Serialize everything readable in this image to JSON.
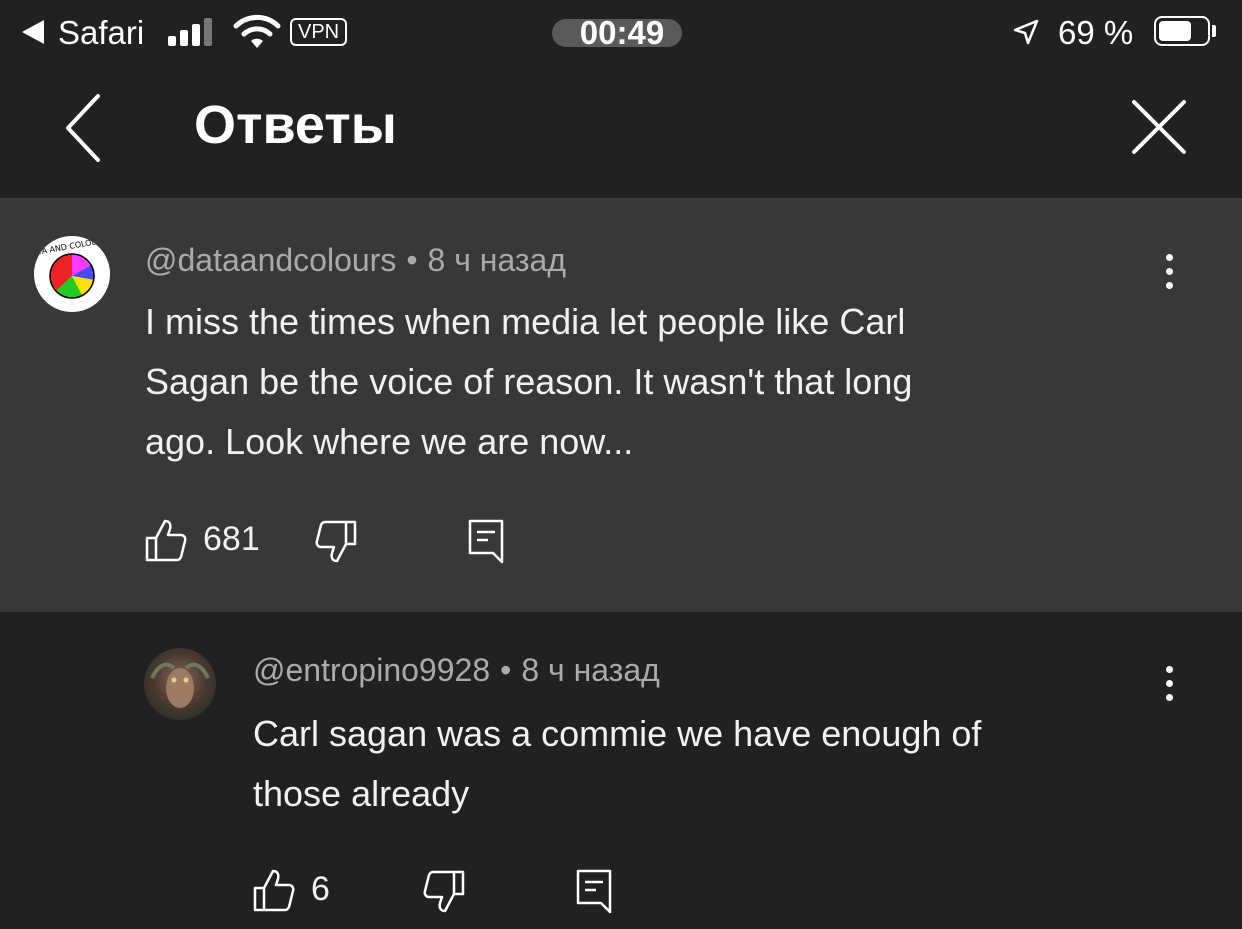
{
  "status_bar": {
    "back_app": "Safari",
    "vpn": "VPN",
    "time": "00:49",
    "battery_pct": "69 %"
  },
  "header": {
    "title": "Ответы"
  },
  "comments": [
    {
      "author": "@dataandcolours",
      "separator": "•",
      "time": "8 ч назад",
      "text_lines": [
        "I miss the times when media let people like Carl",
        "Sagan be the voice of reason.   It wasn't that long",
        "ago. Look where we are now..."
      ],
      "likes": "681",
      "avatar_logo_text": "DATA AND COLOURS"
    },
    {
      "author": "@entropino9928",
      "separator": "•",
      "time": "8 ч назад",
      "text_lines": [
        "Carl sagan was a commie we have enough of",
        "those already"
      ],
      "likes": "6"
    }
  ],
  "colors": {
    "background": "#212121",
    "highlight_bg": "#383838",
    "meta_text": "#aaaaaa",
    "text": "#f1f1f1"
  },
  "icons": {
    "like": "thumbs-up-icon",
    "dislike": "thumbs-down-icon",
    "reply": "reply-comment-icon",
    "more": "more-vertical-icon",
    "back": "chevron-left-icon",
    "close": "close-icon"
  }
}
